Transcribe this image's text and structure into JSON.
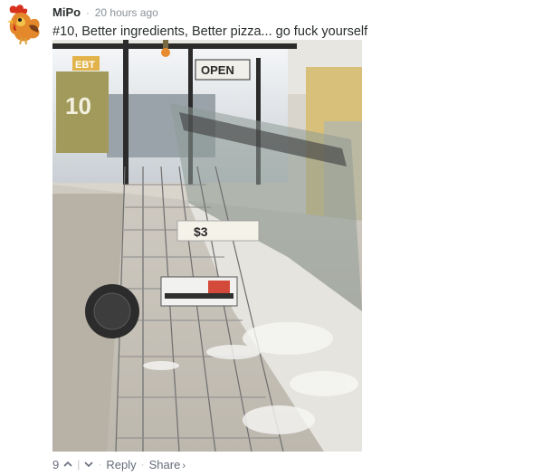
{
  "comment": {
    "username": "MiPo",
    "separator": "·",
    "timestamp": "20 hours ago",
    "message": "#10, Better ingredients, Better pizza... go fuck yourself"
  },
  "photo": {
    "signs": {
      "ebt": "EBT",
      "open": "OPEN",
      "price": "$3",
      "poster": "10"
    }
  },
  "footer": {
    "upvote_count": "9",
    "divider": "|",
    "dot": "·",
    "reply_label": "Reply",
    "share_label": "Share",
    "share_arrow": "›"
  },
  "colors": {
    "username": "#2a2e2e",
    "meta": "#8b9299",
    "footer_text": "#656c7a"
  }
}
